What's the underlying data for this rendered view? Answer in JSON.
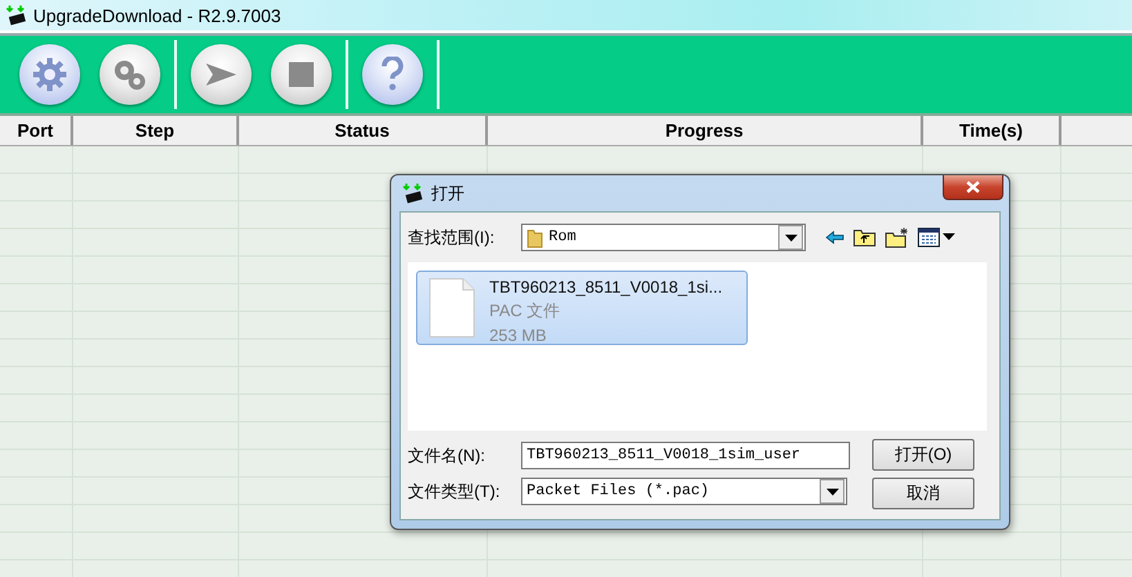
{
  "window": {
    "title": "UpgradeDownload - R2.9.7003"
  },
  "toolbar": {
    "groups": [
      [
        {
          "kind": "gear",
          "disabled": false
        },
        {
          "kind": "gears",
          "disabled": true
        }
      ],
      [
        {
          "kind": "play",
          "disabled": true
        },
        {
          "kind": "stop",
          "disabled": true
        }
      ],
      [
        {
          "kind": "help",
          "disabled": false
        }
      ]
    ]
  },
  "table": {
    "columns": [
      "Port",
      "Step",
      "Status",
      "Progress",
      "Time(s)"
    ]
  },
  "dialog": {
    "title": "打开",
    "look_in": {
      "label": "查找范围(I):",
      "value": "Rom"
    },
    "files": [
      {
        "name": "TBT960213_8511_V0018_1si...",
        "type": "PAC 文件",
        "size": "253 MB",
        "selected": true
      }
    ],
    "file_name": {
      "label": "文件名(N):",
      "value": "TBT960213_8511_V0018_1sim_user"
    },
    "file_type": {
      "label": "文件类型(T):",
      "value": "Packet Files (*.pac)"
    },
    "buttons": [
      "打开(O)",
      "取消"
    ]
  }
}
